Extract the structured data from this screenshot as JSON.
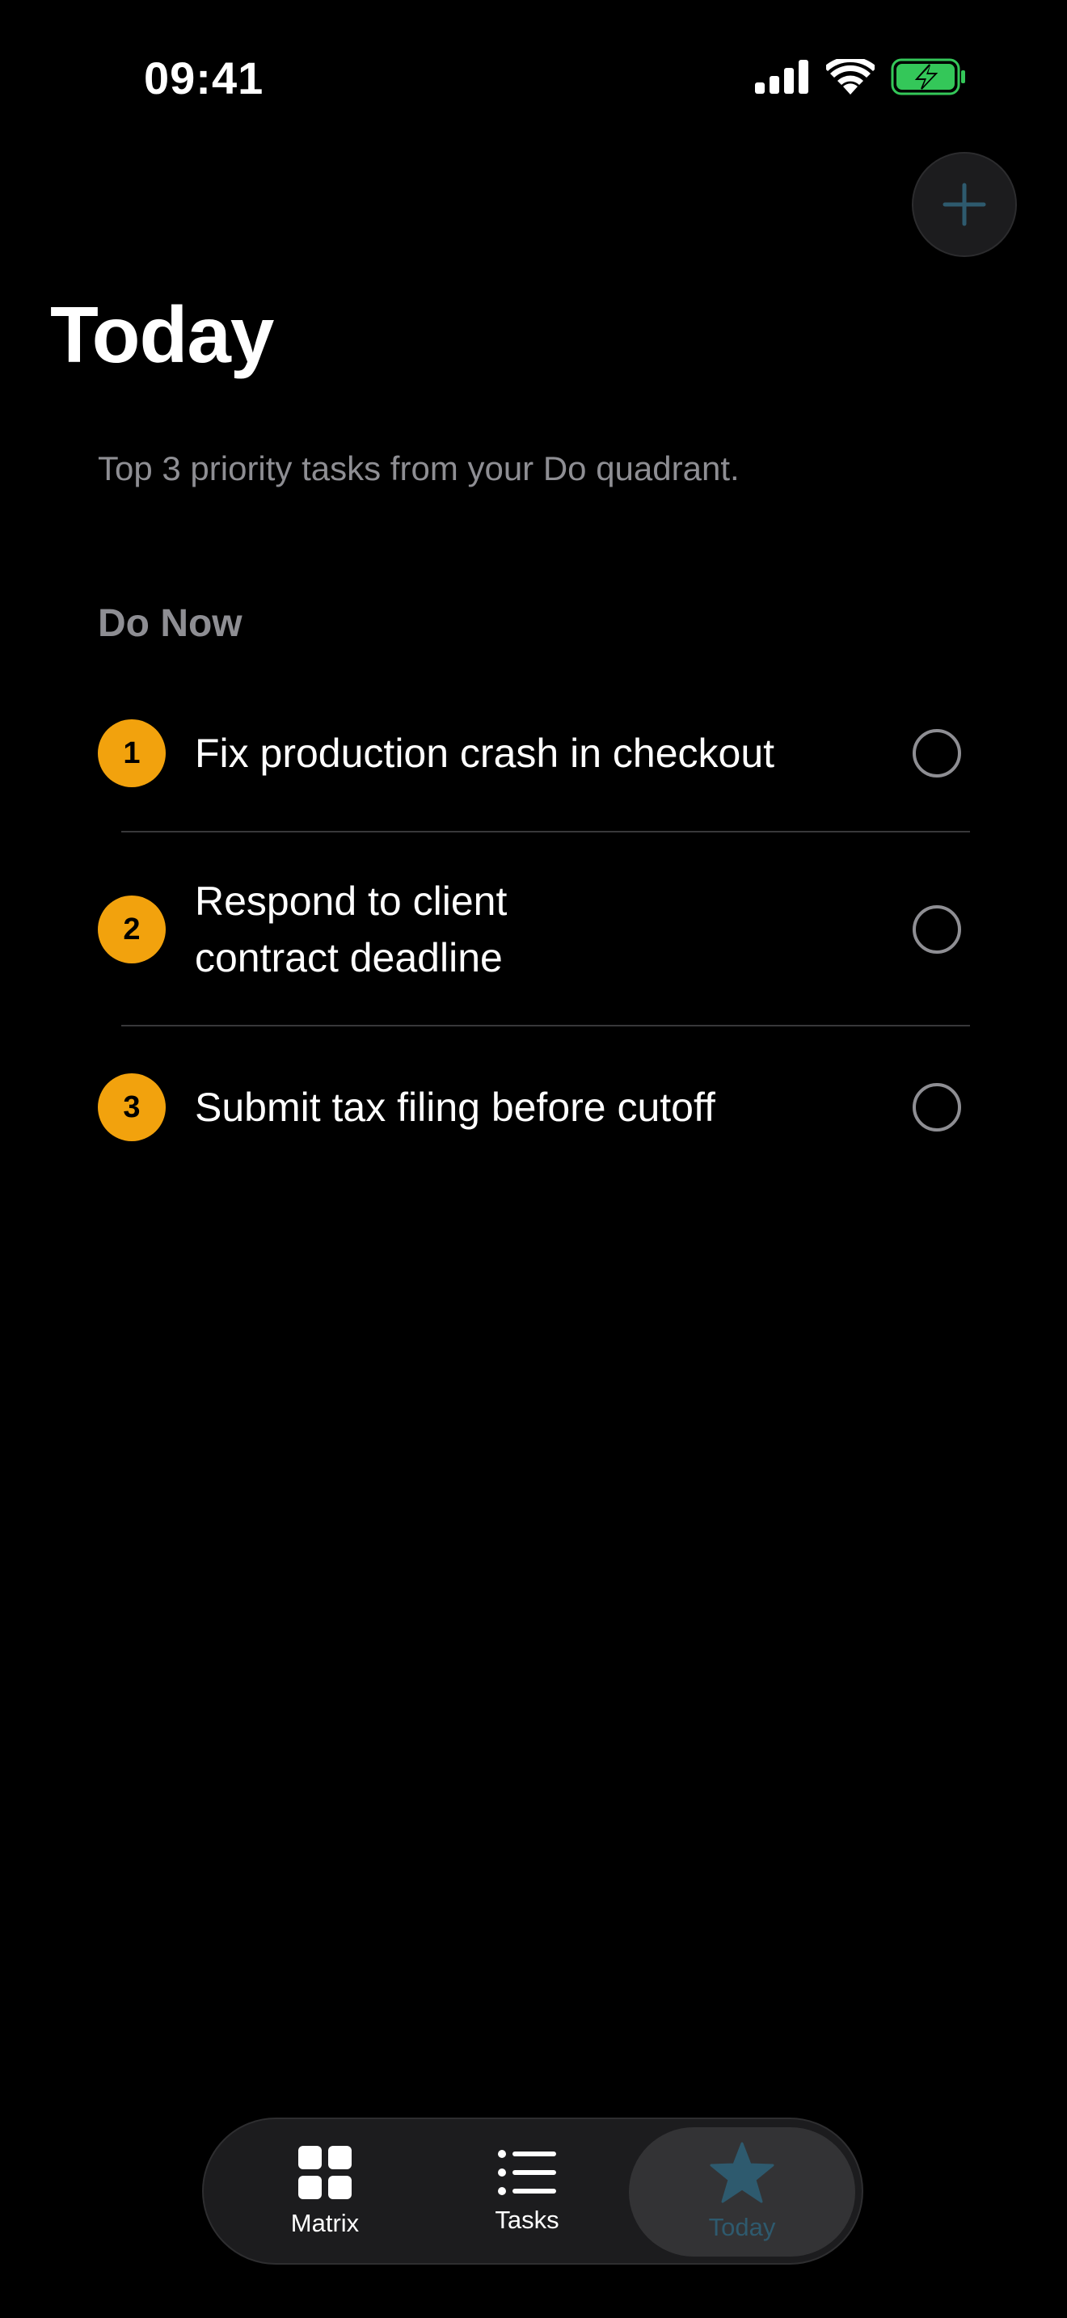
{
  "status_bar": {
    "time": "09:41"
  },
  "header": {
    "title": "Today",
    "subtitle": "Top 3 priority tasks from your Do quadrant.",
    "add_icon": "plus-icon"
  },
  "section": {
    "title": "Do Now"
  },
  "tasks": [
    {
      "rank": "1",
      "title": "Fix production crash in checkout",
      "completed": false
    },
    {
      "rank": "2",
      "title": "Respond to client contract deadline",
      "completed": false
    },
    {
      "rank": "3",
      "title": "Submit tax filing before cutoff",
      "completed": false
    }
  ],
  "tab_bar": {
    "tabs": [
      {
        "label": "Matrix",
        "icon": "grid-icon",
        "selected": false
      },
      {
        "label": "Tasks",
        "icon": "list-icon",
        "selected": false
      },
      {
        "label": "Today",
        "icon": "star-icon",
        "selected": true
      }
    ]
  },
  "colors": {
    "background": "#000000",
    "accent": "#2e5a6e",
    "badge": "#f2a20d",
    "secondary_text": "#8e8e93",
    "battery": "#34c759"
  }
}
